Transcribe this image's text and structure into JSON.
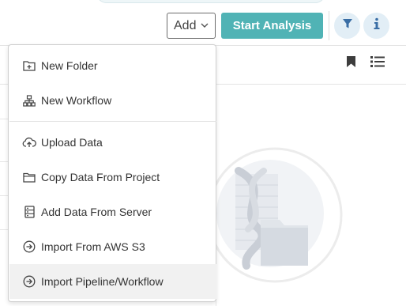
{
  "toolbar": {
    "add_label": "Add",
    "start_analysis_label": "Start Analysis",
    "filter_icon": "filter-icon",
    "info_icon": "info-icon"
  },
  "header_icons": {
    "bookmark_icon": "bookmark-icon",
    "list_view_icon": "list-view-icon"
  },
  "add_menu": {
    "items": [
      {
        "label": "New Folder",
        "icon": "new-folder-icon"
      },
      {
        "label": "New Workflow",
        "icon": "workflow-icon"
      },
      {
        "label": "Upload Data",
        "icon": "cloud-upload-icon"
      },
      {
        "label": "Copy Data From Project",
        "icon": "folder-icon"
      },
      {
        "label": "Add Data From Server",
        "icon": "server-icon"
      },
      {
        "label": "Import From AWS S3",
        "icon": "arrow-circle-right-icon"
      },
      {
        "label": "Import Pipeline/Workflow",
        "icon": "arrow-circle-right-icon"
      }
    ],
    "highlighted_item": "Import Pipeline/Workflow"
  },
  "colors": {
    "primary": "#50b3b5",
    "icon_button_bg": "#e2eef6",
    "icon_blue": "#3a6ea5"
  }
}
